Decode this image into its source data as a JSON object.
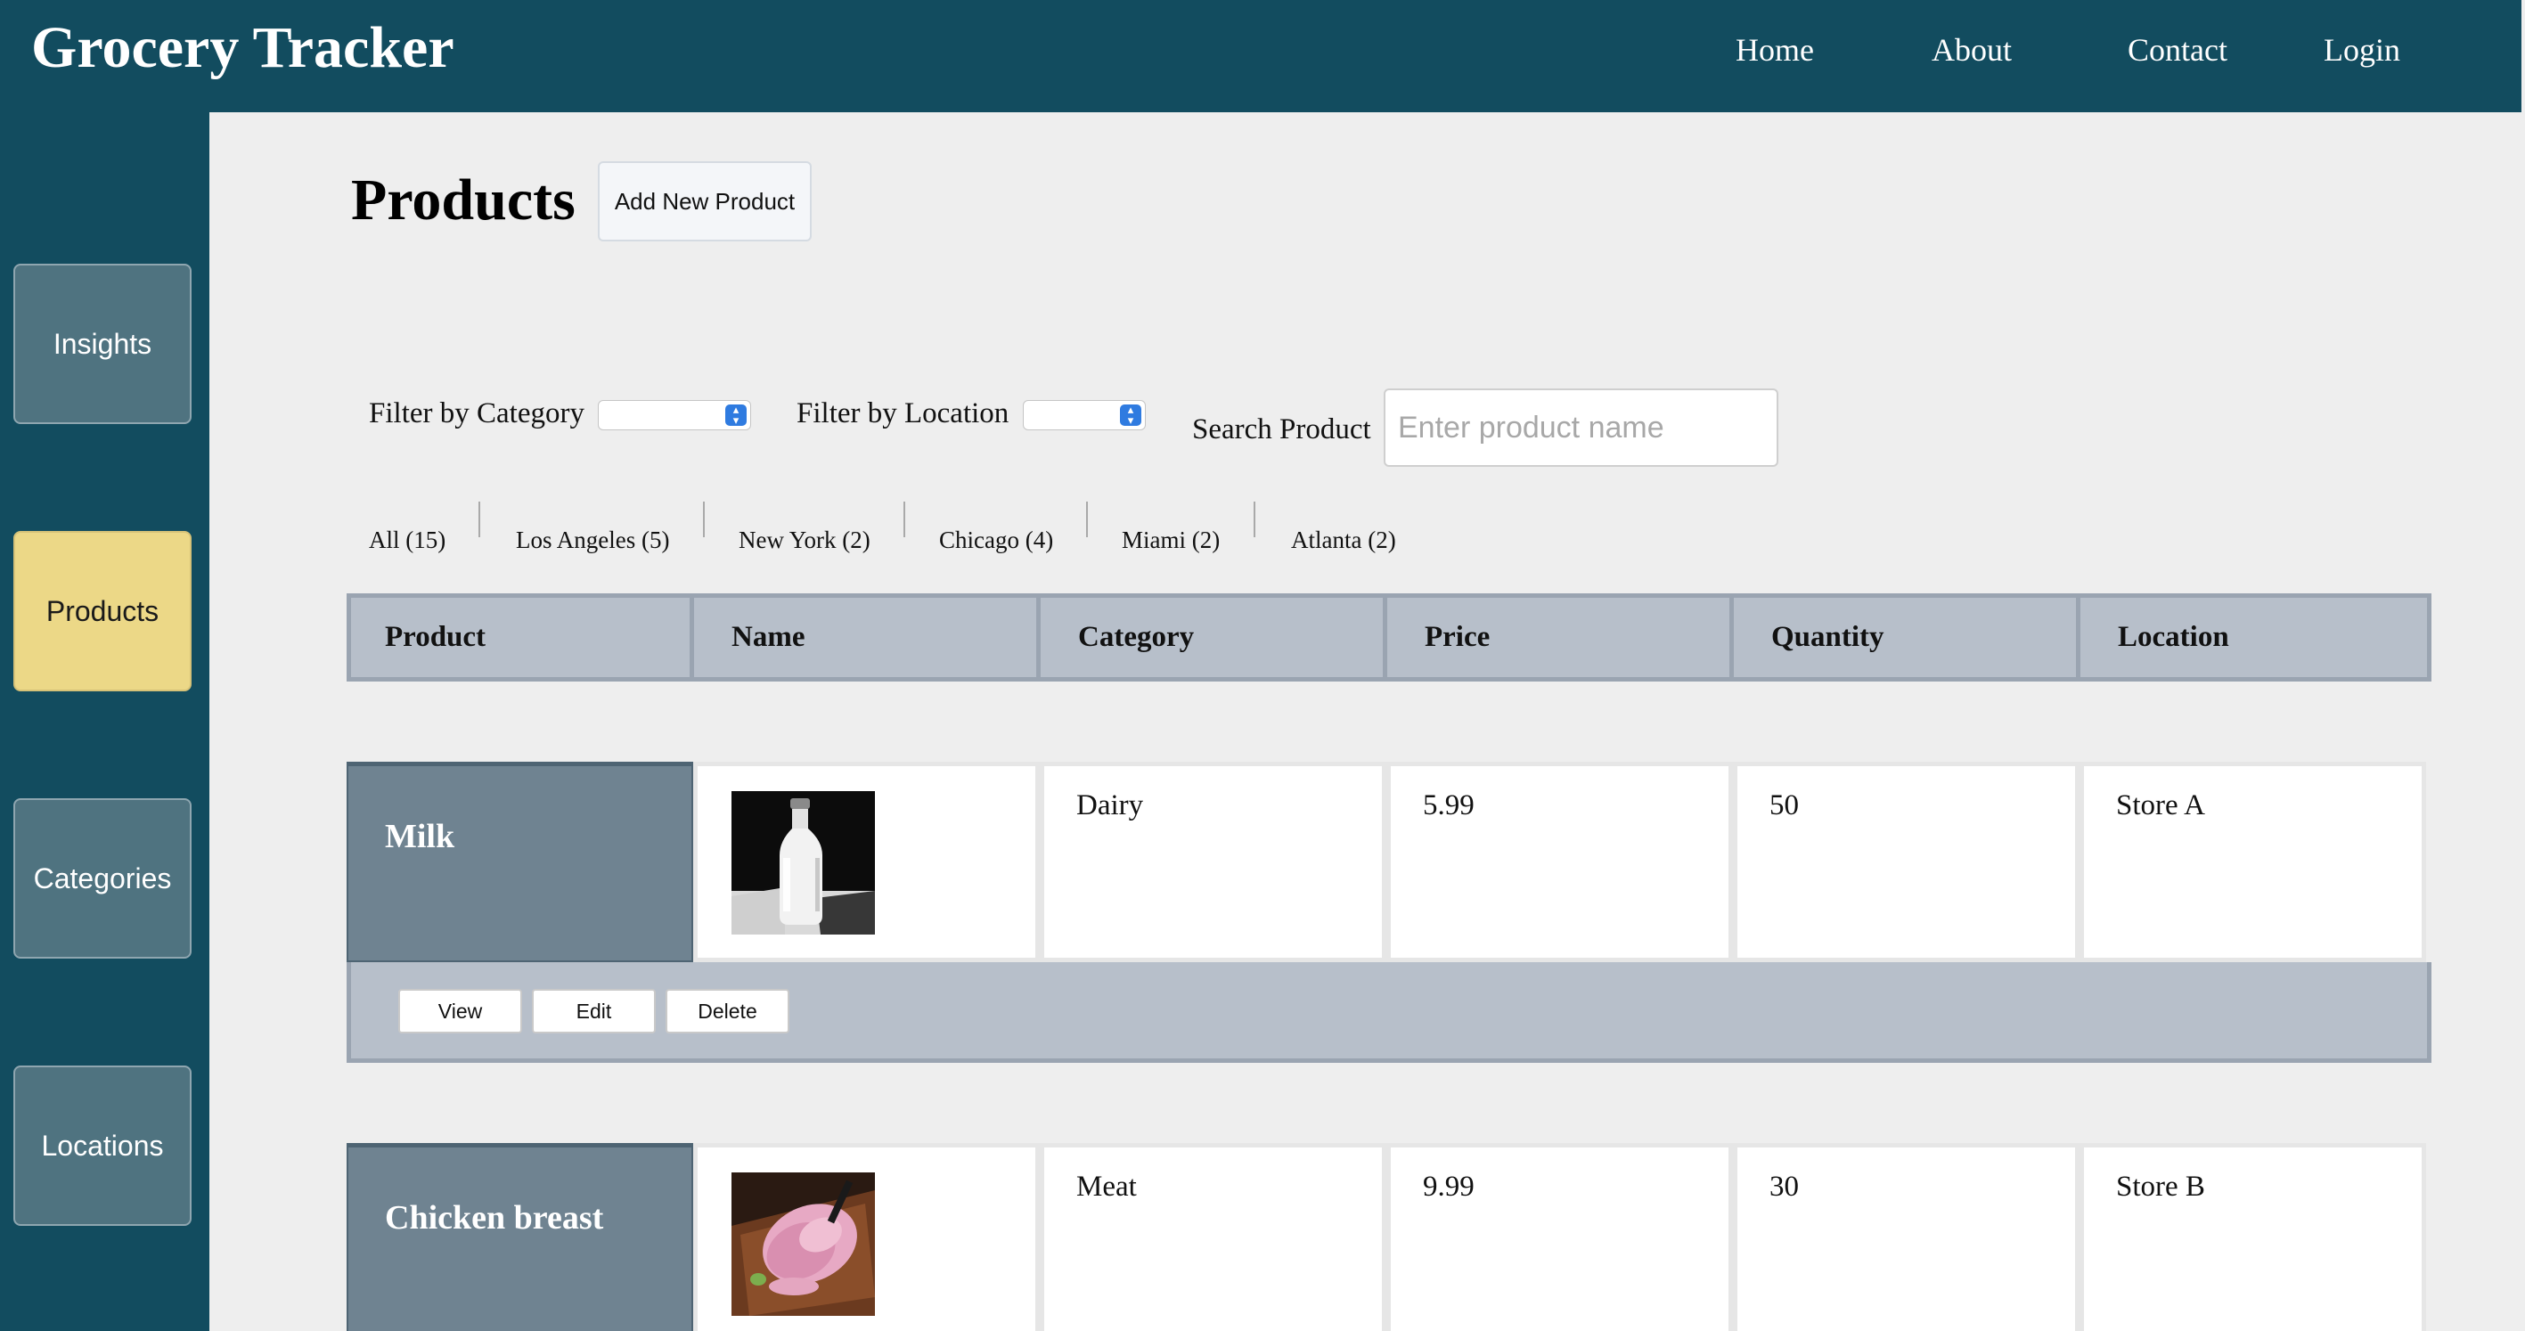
{
  "app": {
    "title": "Grocery Tracker"
  },
  "nav": {
    "home": "Home",
    "about": "About",
    "contact": "Contact",
    "login": "Login"
  },
  "sidebar": {
    "items": [
      {
        "label": "Insights",
        "active": false
      },
      {
        "label": "Products",
        "active": true
      },
      {
        "label": "Categories",
        "active": false
      },
      {
        "label": "Locations",
        "active": false
      }
    ]
  },
  "page": {
    "title": "Products",
    "add_button": "Add New Product"
  },
  "filters": {
    "category_label": "Filter by Category",
    "category_value": "",
    "location_label": "Filter by Location",
    "location_value": "",
    "search_label": "Search Product",
    "search_placeholder": "Enter product name",
    "search_value": ""
  },
  "location_tabs": [
    "All (15)",
    "Los Angeles (5)",
    "New York (2)",
    "Chicago (4)",
    "Miami (2)",
    "Atlanta (2)"
  ],
  "table": {
    "columns": [
      "Product",
      "Name",
      "Category",
      "Price",
      "Quantity",
      "Location"
    ],
    "rows": [
      {
        "product": "Milk",
        "image": "milk-bottle-photo",
        "category": "Dairy",
        "price": "5.99",
        "quantity": "50",
        "location": "Store A"
      },
      {
        "product": "Chicken breast",
        "image": "raw-chicken-photo",
        "category": "Meat",
        "price": "9.99",
        "quantity": "30",
        "location": "Store B"
      }
    ],
    "actions": {
      "view": "View",
      "edit": "Edit",
      "delete": "Delete"
    }
  },
  "colors": {
    "header": "#124c5f",
    "sidebar_active": "#ecd887",
    "sidebar_button": "#4f7380",
    "product_cell": "#6f8391",
    "table_header": "#b7bfca"
  }
}
